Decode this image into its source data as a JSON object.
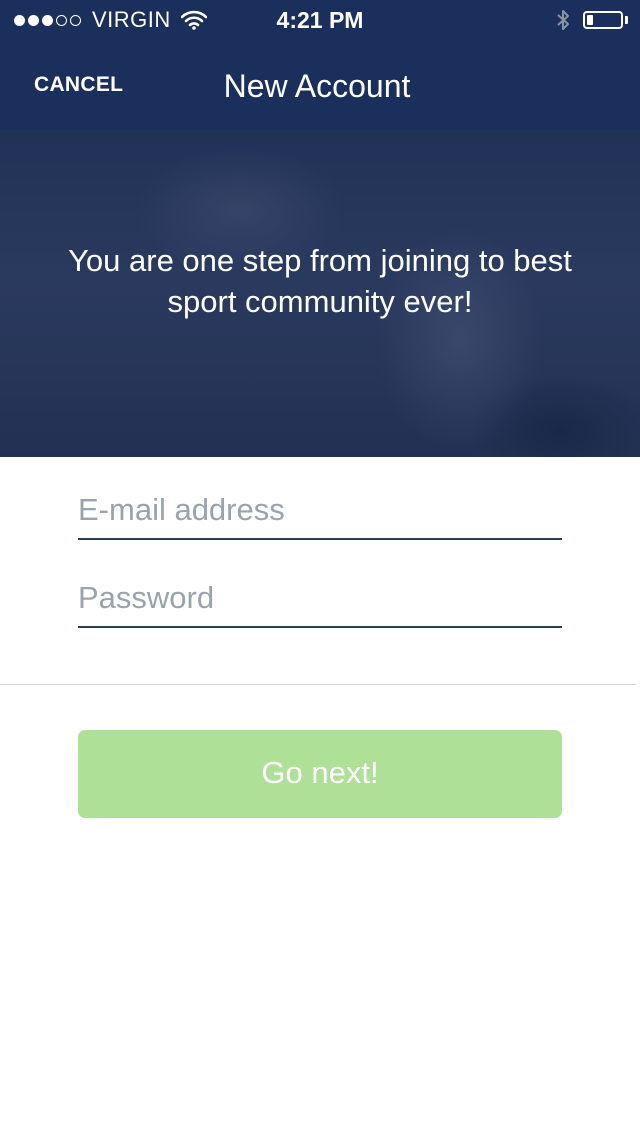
{
  "status_bar": {
    "carrier": "VIRGIN",
    "time": "4:21 PM",
    "signal_bars_filled": 3,
    "signal_bars_total": 5,
    "battery_level": 0.2
  },
  "nav": {
    "cancel_label": "CANCEL",
    "title": "New Account"
  },
  "hero": {
    "message": "You are one step from joining to best sport community ever!"
  },
  "form": {
    "email_placeholder": "E-mail address",
    "email_value": "",
    "password_placeholder": "Password",
    "password_value": ""
  },
  "actions": {
    "go_next_label": "Go next!"
  },
  "colors": {
    "nav_background": "#1b2f5c",
    "button_background": "#aee098",
    "field_underline": "#2c3e52",
    "placeholder": "#9aa3ab"
  },
  "icons": {
    "wifi": "wifi-icon",
    "bluetooth": "bluetooth-icon",
    "battery": "battery-icon"
  }
}
